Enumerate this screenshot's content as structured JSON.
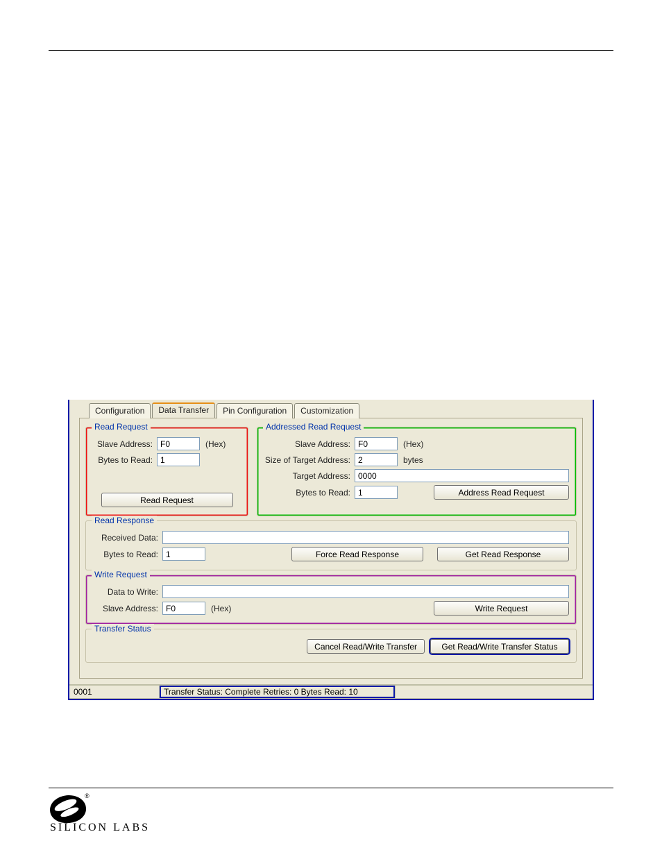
{
  "tabs": {
    "configuration": "Configuration",
    "data_transfer": "Data Transfer",
    "pin_configuration": "Pin Configuration",
    "customization": "Customization"
  },
  "read_request": {
    "title": "Read Request",
    "slave_label": "Slave Address:",
    "slave_value": "F0",
    "slave_unit": "(Hex)",
    "bytes_label": "Bytes to Read:",
    "bytes_value": "1",
    "button": "Read Request"
  },
  "addressed_read_request": {
    "title": "Addressed Read Request",
    "slave_label": "Slave Address:",
    "slave_value": "F0",
    "slave_unit": "(Hex)",
    "size_label": "Size of Target Address:",
    "size_value": "2",
    "size_unit": "bytes",
    "target_label": "Target Address:",
    "target_value": "0000",
    "bytes_label": "Bytes to Read:",
    "bytes_value": "1",
    "button": "Address Read Request"
  },
  "read_response": {
    "title": "Read Response",
    "received_label": "Received Data:",
    "received_value": "",
    "bytes_label": "Bytes to Read:",
    "bytes_value": "1",
    "force_button": "Force Read Response",
    "get_button": "Get Read Response"
  },
  "write_request": {
    "title": "Write Request",
    "data_label": "Data to Write:",
    "data_value": "",
    "slave_label": "Slave Address:",
    "slave_value": "F0",
    "slave_unit": "(Hex)",
    "button": "Write Request"
  },
  "transfer_status": {
    "title": "Transfer Status",
    "cancel_button": "Cancel Read/Write Transfer",
    "get_button": "Get Read/Write Transfer Status"
  },
  "status_bar": {
    "left": "0001",
    "center": "Transfer Status: Complete  Retries: 0  Bytes Read: 10"
  },
  "logo": {
    "text": "SILICON LABS",
    "reg": "®"
  }
}
